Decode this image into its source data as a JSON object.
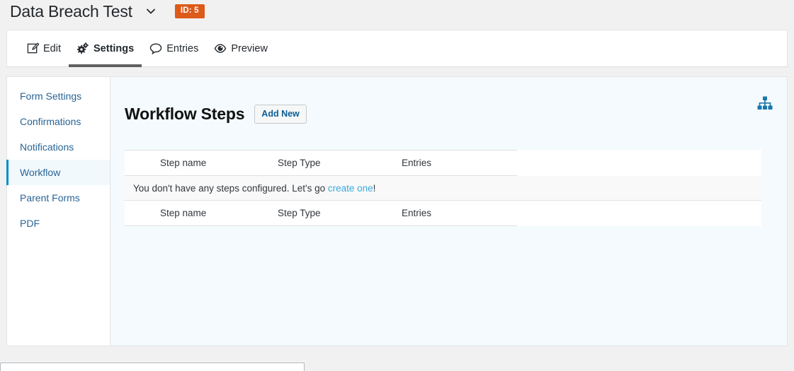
{
  "header": {
    "form_title": "Data Breach Test",
    "chevron_icon": "chevron-down-icon",
    "id_badge": "ID: 5"
  },
  "tabs": [
    {
      "label": "Edit",
      "icon": "edit-pencil-icon",
      "active": false
    },
    {
      "label": "Settings",
      "icon": "gears-icon",
      "active": true
    },
    {
      "label": "Entries",
      "icon": "speech-bubble-icon",
      "active": false
    },
    {
      "label": "Preview",
      "icon": "eye-icon",
      "active": false
    }
  ],
  "sidebar": {
    "items": [
      {
        "label": "Form Settings",
        "active": false
      },
      {
        "label": "Confirmations",
        "active": false
      },
      {
        "label": "Notifications",
        "active": false
      },
      {
        "label": "Workflow",
        "active": true
      },
      {
        "label": "Parent Forms",
        "active": false
      },
      {
        "label": "PDF",
        "active": false
      }
    ]
  },
  "content": {
    "section_title": "Workflow Steps",
    "add_new_label": "Add New",
    "sitemap_icon": "sitemap-icon",
    "table": {
      "columns": [
        "Step name",
        "Step Type",
        "Entries"
      ],
      "rows": [],
      "empty_message_prefix": "You don't have any steps configured. Let's go ",
      "empty_message_link": "create one",
      "empty_message_suffix": "!"
    }
  },
  "colors": {
    "accent_blue": "#0090c4",
    "link_blue": "#2a6496",
    "badge_orange": "#dd5a1a",
    "panel_bg": "#f4fafd",
    "page_bg": "#f1f1f1",
    "active_underline": "#606060"
  }
}
